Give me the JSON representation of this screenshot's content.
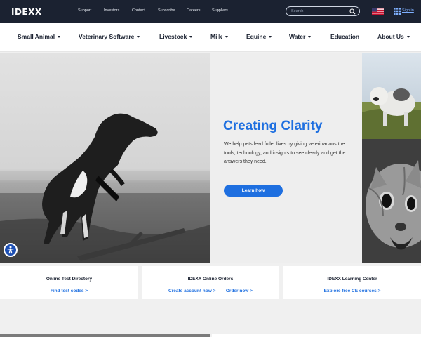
{
  "topbar": {
    "logo": "IDEXX",
    "links": [
      "Support",
      "Investors",
      "Contact",
      "Subscribe",
      "Careers",
      "Suppliers"
    ],
    "search_placeholder": "Search",
    "sign_in": "Sign in"
  },
  "nav": {
    "items": [
      {
        "label": "Small Animal"
      },
      {
        "label": "Veterinary Software"
      },
      {
        "label": "Livestock"
      },
      {
        "label": "Milk"
      },
      {
        "label": "Equine"
      },
      {
        "label": "Water"
      },
      {
        "label": "Education"
      },
      {
        "label": "About Us"
      }
    ]
  },
  "hero": {
    "title": "Creating Clarity",
    "text": "We help pets lead fuller lives by giving veterinarians the tools, technology, and insights to see clearly and get the answers they need.",
    "button": "Learn how"
  },
  "cards": [
    {
      "title": "Online Test Directory",
      "links": [
        "Find test codes >"
      ]
    },
    {
      "title": "IDEXX Online Orders",
      "links": [
        "Create account now >",
        "Order now >"
      ]
    },
    {
      "title": "IDEXX Learning Center",
      "links": [
        "Explore free CE courses >"
      ]
    }
  ],
  "colors": {
    "topbar": "#1b2231",
    "accent": "#1e6fe0",
    "panel": "#eeeeee"
  },
  "icons": [
    "search-icon",
    "us-flag-icon",
    "grid-icon",
    "accessibility-icon",
    "chevron-down-icon"
  ]
}
